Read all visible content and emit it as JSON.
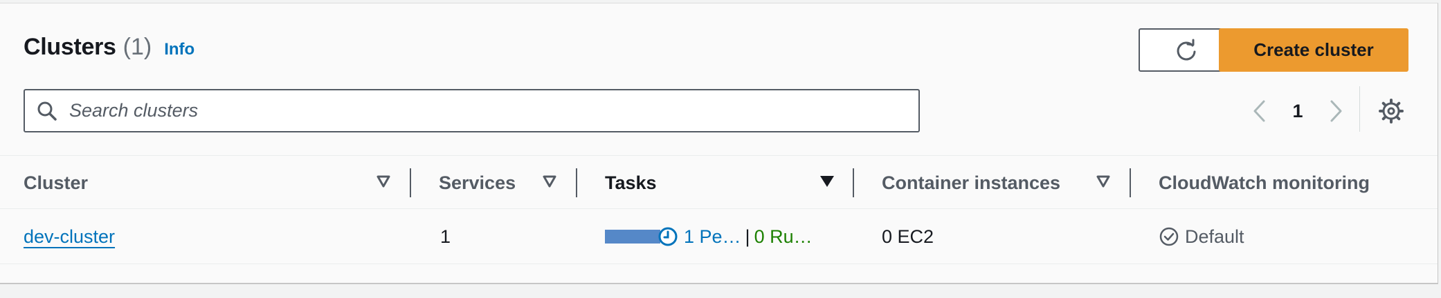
{
  "header": {
    "title": "Clusters",
    "count": "(1)",
    "info_label": "Info",
    "create_label": "Create cluster"
  },
  "search": {
    "placeholder": "Search clusters",
    "value": ""
  },
  "pagination": {
    "current_page": "1"
  },
  "table": {
    "columns": [
      {
        "label": "Cluster"
      },
      {
        "label": "Services"
      },
      {
        "label": "Tasks"
      },
      {
        "label": "Container instances"
      },
      {
        "label": "CloudWatch monitoring"
      }
    ],
    "rows": [
      {
        "cluster": "dev-cluster",
        "services": "1",
        "tasks_pending": "1 Pe…",
        "tasks_separator": "|",
        "tasks_running": "0 Ru…",
        "container_instances": "0 EC2",
        "cloudwatch": "Default"
      }
    ]
  },
  "colors": {
    "primary_button": "#ec9a2f",
    "link": "#0073bb",
    "running": "#1d8102",
    "task_bar": "#5588c8"
  },
  "icons": [
    "refresh-icon",
    "search-icon",
    "chevron-left-icon",
    "chevron-right-icon",
    "gear-icon",
    "sort-icon",
    "clock-icon",
    "check-circle-icon"
  ]
}
